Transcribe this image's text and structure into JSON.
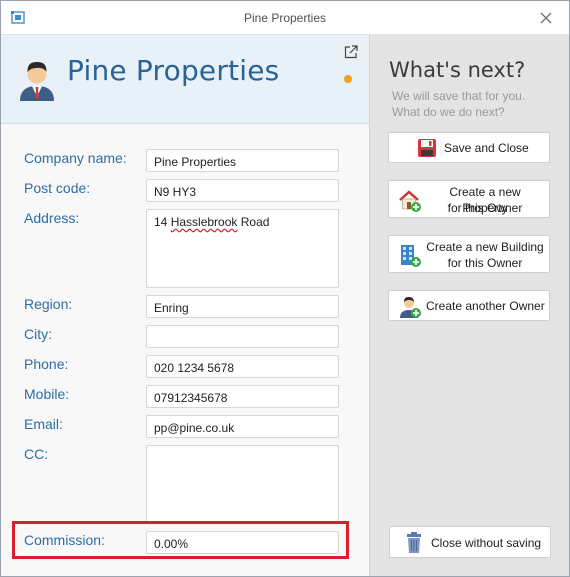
{
  "window": {
    "title": "Pine Properties"
  },
  "header": {
    "company_title": "Pine Properties",
    "status_color": "#f0a020"
  },
  "form": {
    "fields": [
      {
        "label": "Company name:",
        "value": "Pine Properties"
      },
      {
        "label": "Post code:",
        "value": "N9 HY3"
      },
      {
        "label": "Address:",
        "value_prefix": "14 ",
        "value_spell": "Hasslebrook",
        "value_suffix": " Road"
      },
      {
        "label": "Region:",
        "value": "Enring"
      },
      {
        "label": "City:",
        "value": ""
      },
      {
        "label": "Phone:",
        "value": "020 1234 5678"
      },
      {
        "label": "Mobile:",
        "value": "07912345678"
      },
      {
        "label": "Email:",
        "value": "pp@pine.co.uk"
      },
      {
        "label": "CC:",
        "value": ""
      },
      {
        "label": "Commission:",
        "value": "0.00%"
      }
    ]
  },
  "sidebar": {
    "title": "What's next?",
    "subtitle_line1": "We will save that for you.",
    "subtitle_line2": "What do we do next?",
    "buttons": {
      "save_close": "Save and Close",
      "new_property_line1": "Create a new Property",
      "new_property_line2": "for this Owner",
      "new_building_line1": "Create a new Building",
      "new_building_line2": "for this Owner",
      "another_owner": "Create another Owner",
      "close_without_saving": "Close without saving"
    }
  },
  "colors": {
    "label": "#2e6da4",
    "title": "#2a6496",
    "highlight_border": "#d81e2c"
  }
}
